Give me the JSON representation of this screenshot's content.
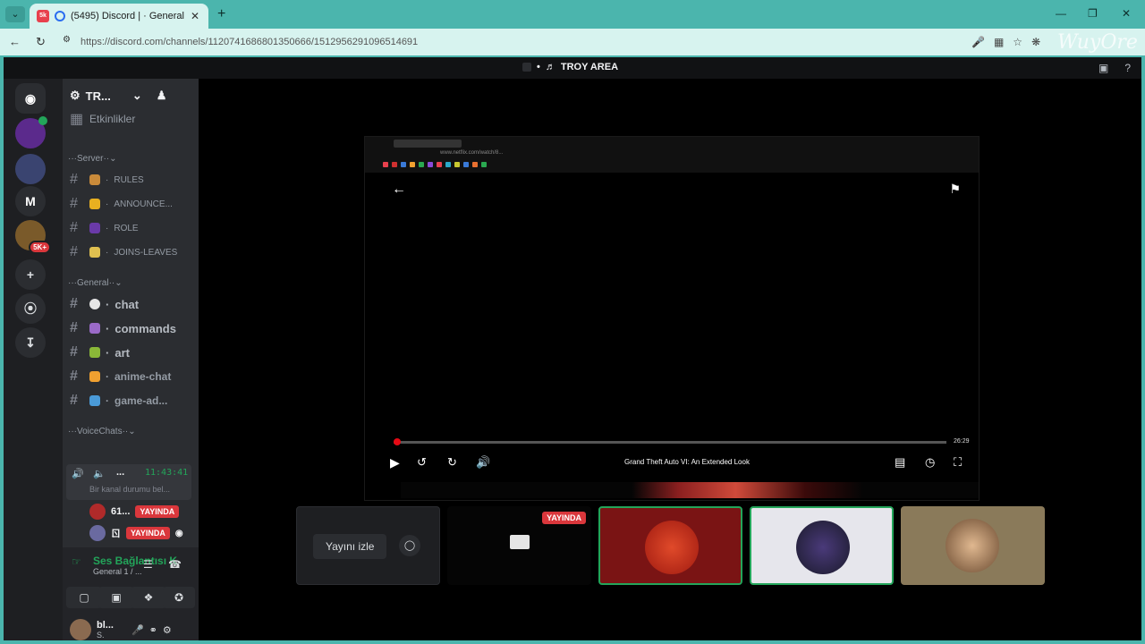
{
  "browser": {
    "tab_title": "(5495) Discord | · General",
    "tab_close": "✕",
    "new_tab": "+",
    "url": "https://discord.com/channels/1120741686801350666/1512956291096514691",
    "watermark_right": "WuyOre"
  },
  "topbar": {
    "channel_title": "TROY AREA"
  },
  "guilds": {
    "badge_5k": "5K+",
    "m_label": "M"
  },
  "sidebar": {
    "server_name": "TR...",
    "events_label": "Etkinlikler",
    "categories": {
      "server": "Server",
      "general": "General",
      "voice": "VoiceChats"
    },
    "server_channels": [
      {
        "label": "RULES"
      },
      {
        "label": "ANNOUNCE..."
      },
      {
        "label": "ROLE"
      },
      {
        "label": "JOINS-LEAVES"
      }
    ],
    "general_channels": [
      {
        "label": "chat"
      },
      {
        "label": "commands"
      },
      {
        "label": "art"
      },
      {
        "label": "anime-chat"
      },
      {
        "label": "game-ad..."
      }
    ],
    "voice_channel": {
      "name": "...",
      "time": "11:43:41",
      "status_placeholder": "Bir kanal durumu bel..."
    },
    "voice_users": [
      {
        "name": "61...",
        "badge": "YAYINDA"
      },
      {
        "name": "ㄖ",
        "badge": "YAYINDA"
      }
    ]
  },
  "panel": {
    "connection": "Ses Bağlantısı K",
    "sub": "General 1 / ...",
    "user_name": "bl...",
    "user_status": "S."
  },
  "stream": {
    "mini_url": "www.netflix.com/watch/8...",
    "duration": "26:29",
    "title": "Grand Theft Auto VI: An Extended Look"
  },
  "thumbs": {
    "watch_label": "Yayını izle",
    "live_badge": "YAYINDA"
  }
}
